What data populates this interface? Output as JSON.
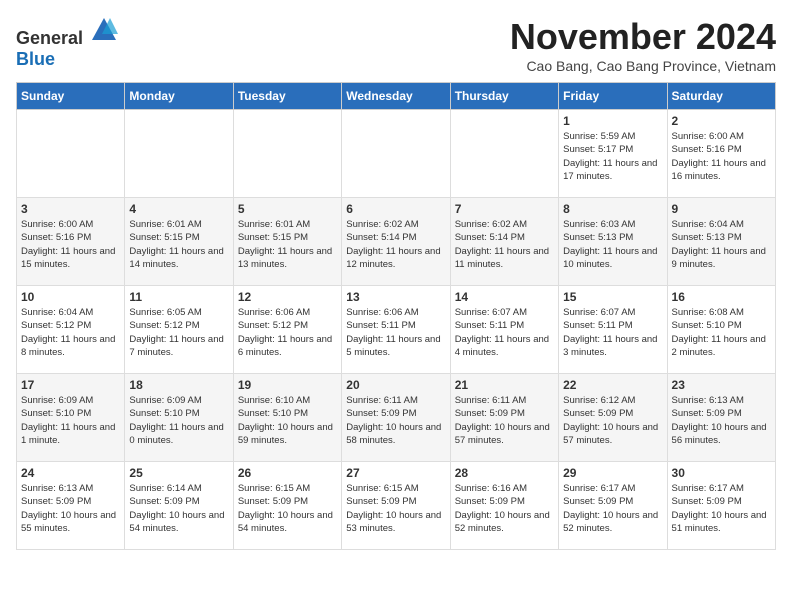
{
  "logo": {
    "general": "General",
    "blue": "Blue"
  },
  "header": {
    "month_title": "November 2024",
    "location": "Cao Bang, Cao Bang Province, Vietnam"
  },
  "weekdays": [
    "Sunday",
    "Monday",
    "Tuesday",
    "Wednesday",
    "Thursday",
    "Friday",
    "Saturday"
  ],
  "weeks": [
    [
      {
        "day": "",
        "info": ""
      },
      {
        "day": "",
        "info": ""
      },
      {
        "day": "",
        "info": ""
      },
      {
        "day": "",
        "info": ""
      },
      {
        "day": "",
        "info": ""
      },
      {
        "day": "1",
        "info": "Sunrise: 5:59 AM\nSunset: 5:17 PM\nDaylight: 11 hours and 17 minutes."
      },
      {
        "day": "2",
        "info": "Sunrise: 6:00 AM\nSunset: 5:16 PM\nDaylight: 11 hours and 16 minutes."
      }
    ],
    [
      {
        "day": "3",
        "info": "Sunrise: 6:00 AM\nSunset: 5:16 PM\nDaylight: 11 hours and 15 minutes."
      },
      {
        "day": "4",
        "info": "Sunrise: 6:01 AM\nSunset: 5:15 PM\nDaylight: 11 hours and 14 minutes."
      },
      {
        "day": "5",
        "info": "Sunrise: 6:01 AM\nSunset: 5:15 PM\nDaylight: 11 hours and 13 minutes."
      },
      {
        "day": "6",
        "info": "Sunrise: 6:02 AM\nSunset: 5:14 PM\nDaylight: 11 hours and 12 minutes."
      },
      {
        "day": "7",
        "info": "Sunrise: 6:02 AM\nSunset: 5:14 PM\nDaylight: 11 hours and 11 minutes."
      },
      {
        "day": "8",
        "info": "Sunrise: 6:03 AM\nSunset: 5:13 PM\nDaylight: 11 hours and 10 minutes."
      },
      {
        "day": "9",
        "info": "Sunrise: 6:04 AM\nSunset: 5:13 PM\nDaylight: 11 hours and 9 minutes."
      }
    ],
    [
      {
        "day": "10",
        "info": "Sunrise: 6:04 AM\nSunset: 5:12 PM\nDaylight: 11 hours and 8 minutes."
      },
      {
        "day": "11",
        "info": "Sunrise: 6:05 AM\nSunset: 5:12 PM\nDaylight: 11 hours and 7 minutes."
      },
      {
        "day": "12",
        "info": "Sunrise: 6:06 AM\nSunset: 5:12 PM\nDaylight: 11 hours and 6 minutes."
      },
      {
        "day": "13",
        "info": "Sunrise: 6:06 AM\nSunset: 5:11 PM\nDaylight: 11 hours and 5 minutes."
      },
      {
        "day": "14",
        "info": "Sunrise: 6:07 AM\nSunset: 5:11 PM\nDaylight: 11 hours and 4 minutes."
      },
      {
        "day": "15",
        "info": "Sunrise: 6:07 AM\nSunset: 5:11 PM\nDaylight: 11 hours and 3 minutes."
      },
      {
        "day": "16",
        "info": "Sunrise: 6:08 AM\nSunset: 5:10 PM\nDaylight: 11 hours and 2 minutes."
      }
    ],
    [
      {
        "day": "17",
        "info": "Sunrise: 6:09 AM\nSunset: 5:10 PM\nDaylight: 11 hours and 1 minute."
      },
      {
        "day": "18",
        "info": "Sunrise: 6:09 AM\nSunset: 5:10 PM\nDaylight: 11 hours and 0 minutes."
      },
      {
        "day": "19",
        "info": "Sunrise: 6:10 AM\nSunset: 5:10 PM\nDaylight: 10 hours and 59 minutes."
      },
      {
        "day": "20",
        "info": "Sunrise: 6:11 AM\nSunset: 5:09 PM\nDaylight: 10 hours and 58 minutes."
      },
      {
        "day": "21",
        "info": "Sunrise: 6:11 AM\nSunset: 5:09 PM\nDaylight: 10 hours and 57 minutes."
      },
      {
        "day": "22",
        "info": "Sunrise: 6:12 AM\nSunset: 5:09 PM\nDaylight: 10 hours and 57 minutes."
      },
      {
        "day": "23",
        "info": "Sunrise: 6:13 AM\nSunset: 5:09 PM\nDaylight: 10 hours and 56 minutes."
      }
    ],
    [
      {
        "day": "24",
        "info": "Sunrise: 6:13 AM\nSunset: 5:09 PM\nDaylight: 10 hours and 55 minutes."
      },
      {
        "day": "25",
        "info": "Sunrise: 6:14 AM\nSunset: 5:09 PM\nDaylight: 10 hours and 54 minutes."
      },
      {
        "day": "26",
        "info": "Sunrise: 6:15 AM\nSunset: 5:09 PM\nDaylight: 10 hours and 54 minutes."
      },
      {
        "day": "27",
        "info": "Sunrise: 6:15 AM\nSunset: 5:09 PM\nDaylight: 10 hours and 53 minutes."
      },
      {
        "day": "28",
        "info": "Sunrise: 6:16 AM\nSunset: 5:09 PM\nDaylight: 10 hours and 52 minutes."
      },
      {
        "day": "29",
        "info": "Sunrise: 6:17 AM\nSunset: 5:09 PM\nDaylight: 10 hours and 52 minutes."
      },
      {
        "day": "30",
        "info": "Sunrise: 6:17 AM\nSunset: 5:09 PM\nDaylight: 10 hours and 51 minutes."
      }
    ]
  ]
}
